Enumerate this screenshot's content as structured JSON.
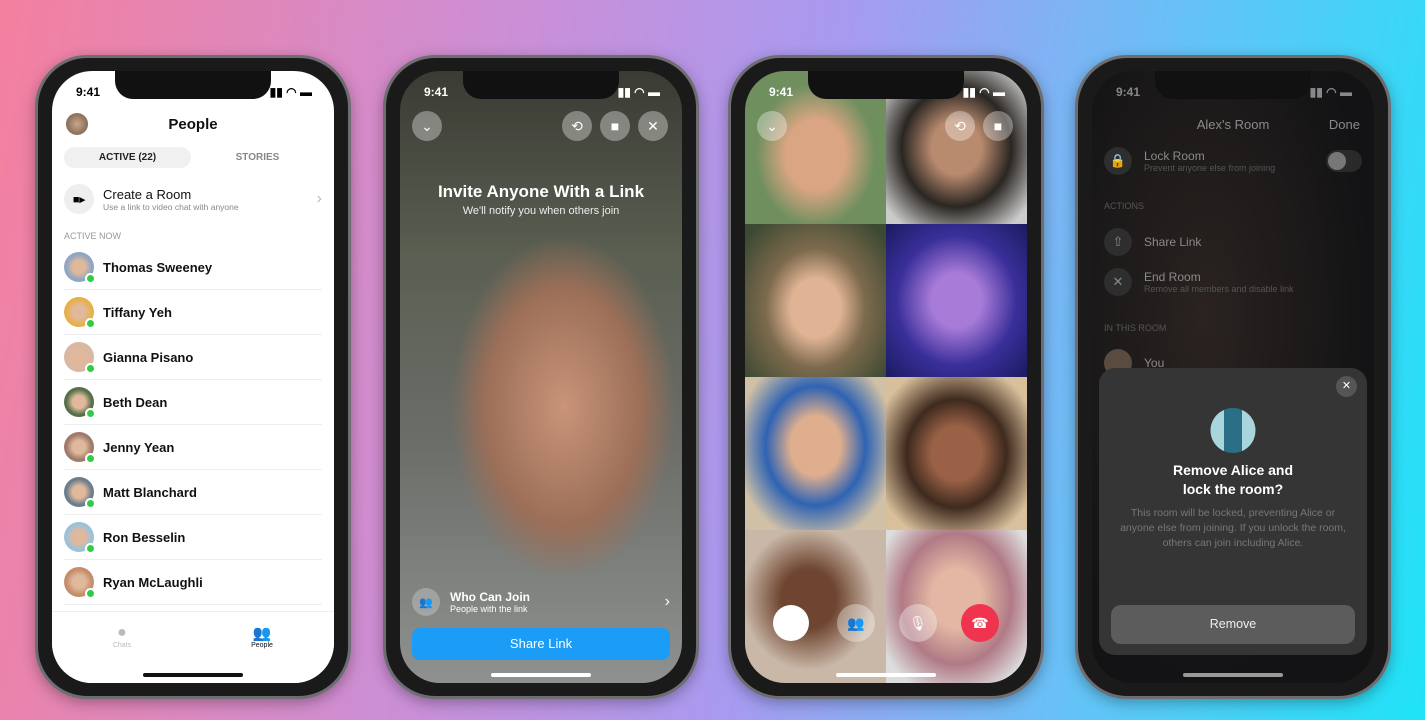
{
  "status_time": "9:41",
  "people": {
    "title": "People",
    "tabs": [
      {
        "label": "ACTIVE (22)",
        "active": true
      },
      {
        "label": "STORIES",
        "active": false
      }
    ],
    "create_room": {
      "title": "Create a Room",
      "subtitle": "Use a link to video chat with anyone"
    },
    "section": "ACTIVE NOW",
    "contacts": [
      "Thomas Sweeney",
      "Tiffany Yeh",
      "Gianna Pisano",
      "Beth Dean",
      "Jenny Yean",
      "Matt Blanchard",
      "Ron Besselin",
      "Ryan McLaughli"
    ],
    "bottom_tabs": [
      {
        "label": "Chats",
        "active": false
      },
      {
        "label": "People",
        "active": true
      }
    ]
  },
  "invite": {
    "title": "Invite Anyone With a Link",
    "subtitle": "We'll notify you when others join",
    "who_can_join": {
      "title": "Who Can Join",
      "subtitle": "People with the link"
    },
    "share_button": "Share Link",
    "accent": "#1a9cf7"
  },
  "call": {
    "end_color": "#f0344f"
  },
  "room": {
    "title": "Alex's Room",
    "done": "Done",
    "lock": {
      "title": "Lock Room",
      "subtitle": "Prevent anyone else from joining",
      "enabled": false
    },
    "actions_header": "ACTIONS",
    "share": "Share Link",
    "end": {
      "title": "End Room",
      "subtitle": "Remove all members and disable link"
    },
    "in_room_header": "IN THIS ROOM",
    "member": "You",
    "dialog": {
      "title_line1": "Remove Alice and",
      "title_line2": "lock the room?",
      "body": "This room will be locked, preventing Alice or anyone else from joining. If you unlock the room, others can join including Alice.",
      "button": "Remove"
    }
  }
}
